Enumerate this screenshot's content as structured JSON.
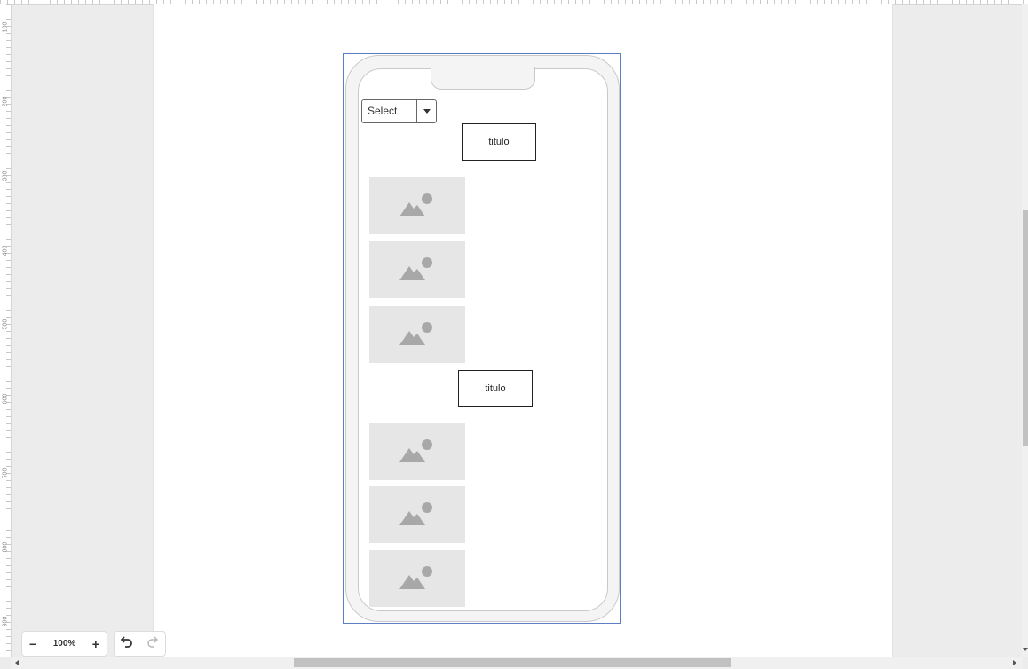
{
  "ruler": {
    "labels": [
      "100",
      "200",
      "300",
      "400",
      "500",
      "600",
      "700",
      "800",
      "900"
    ]
  },
  "dropdown": {
    "value": "Select"
  },
  "titles": [
    {
      "text": "titulo"
    },
    {
      "text": "titulo"
    }
  ],
  "images": {
    "count_section1": 3,
    "count_section2": 3,
    "icon": "image-placeholder-icon"
  },
  "zoom": {
    "minus": "−",
    "level": "100%",
    "plus": "+"
  },
  "history": {
    "undo": "undo-icon",
    "redo": "redo-icon"
  },
  "colors": {
    "selection": "#5b7fc4",
    "placeholder": "#e6e6e6",
    "placeholder_icon": "#a8a8a8"
  }
}
